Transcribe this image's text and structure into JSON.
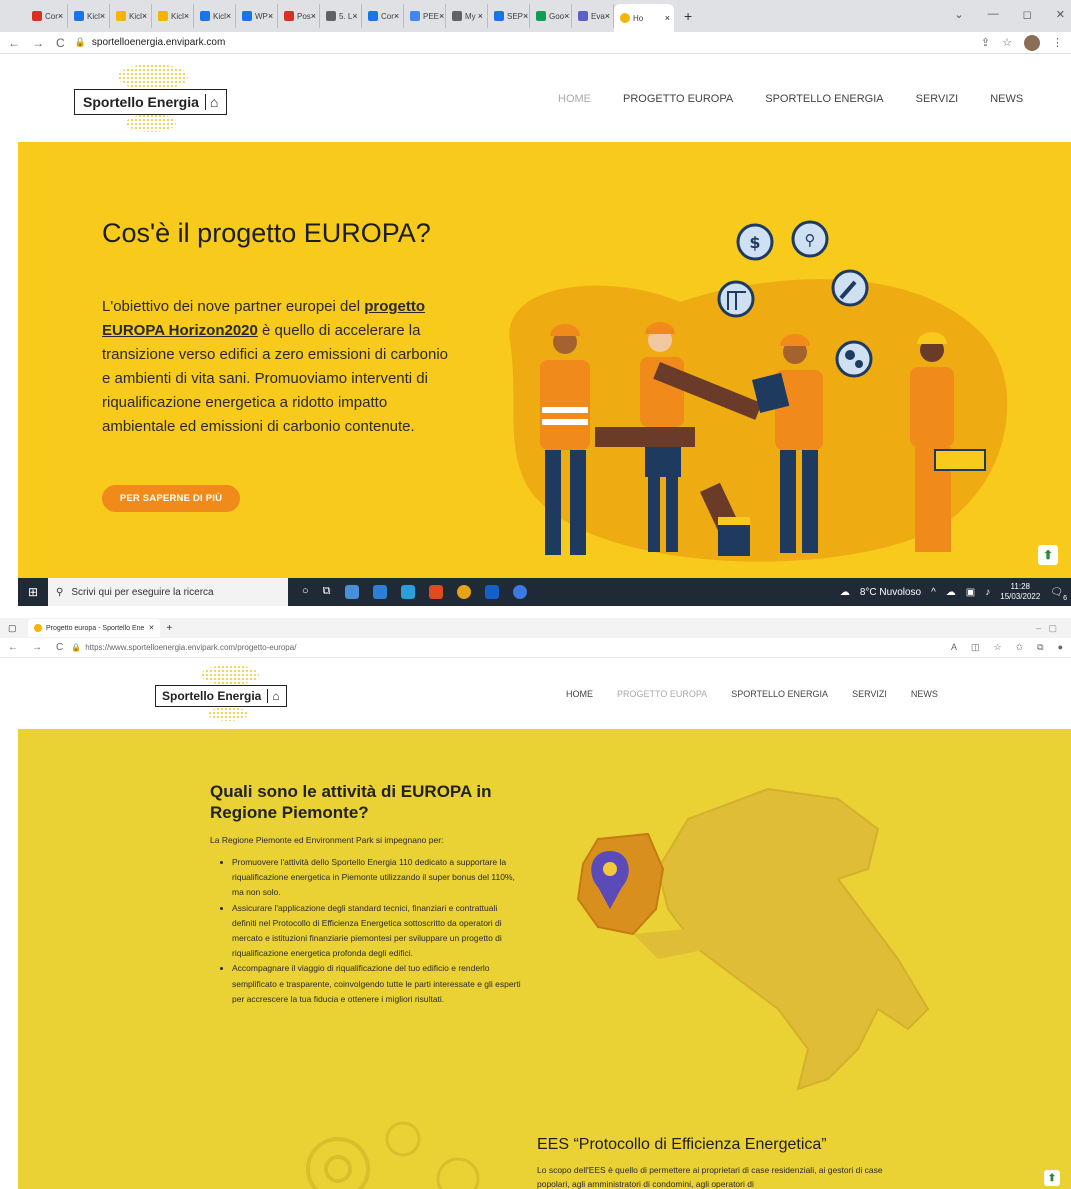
{
  "browser1": {
    "tabs": [
      {
        "label": "Cor",
        "color": "#d93025"
      },
      {
        "label": "Kicl",
        "color": "#1a73e8"
      },
      {
        "label": "Kicl",
        "color": "#f4b400"
      },
      {
        "label": "Kicl",
        "color": "#f4b400"
      },
      {
        "label": "Kicl",
        "color": "#1a73e8"
      },
      {
        "label": "WP",
        "color": "#1a73e8"
      },
      {
        "label": "Pos",
        "color": "#d93025"
      },
      {
        "label": "5. L",
        "color": "#5f6368"
      },
      {
        "label": "Cor",
        "color": "#1a73e8"
      },
      {
        "label": "PEE",
        "color": "#4285f4"
      },
      {
        "label": "My",
        "color": "#5f6368"
      },
      {
        "label": "SEP",
        "color": "#1a73e8"
      },
      {
        "label": "Goo",
        "color": "#0f9d58"
      },
      {
        "label": "Eva",
        "color": "#5b5fc7"
      }
    ],
    "active_tab": "Ho",
    "url": "sportelloenergia.envipark.com"
  },
  "site": {
    "logo_text": "Sportello Energia",
    "logo_symbol": "⌂",
    "menu": [
      "HOME",
      "PROGETTO EUROPA",
      "SPORTELLO ENERGIA",
      "SERVIZI",
      "NEWS"
    ]
  },
  "hero1": {
    "title": "Cos'è il progetto EUROPA?",
    "text_before": "L'obiettivo dei nove partner europei del ",
    "link_text": "progetto EUROPA Horizon2020",
    "text_after": " è quello di accelerare la transizione verso edifici a zero emissioni di carbonio e ambienti di vita sani. Promuoviamo interventi di riqualificazione energetica a ridotto impatto ambientale ed emissioni di carbonio contenute.",
    "cta": "PER SAPERNE DI PIÙ"
  },
  "taskbar": {
    "search_placeholder": "Scrivi qui per eseguire la ricerca",
    "weather": "8°C Nuvoloso",
    "time": "11:28",
    "date": "15/03/2022",
    "notification_count": "6"
  },
  "browser2": {
    "tab_title": "Progetto europa - Sportello Ene",
    "url": "https://www.sportelloenergia.envipark.com/progetto-europa/"
  },
  "section2": {
    "title": "Quali sono le attività di EUROPA in Regione Piemonte?",
    "intro": "La Regione Piemonte ed Environment Park si impegnano per:",
    "bullets": [
      "Promuovere l'attività dello Sportello Energia 110 dedicato a supportare la riqualificazione energetica in Piemonte utilizzando il super bonus del 110%, ma non solo.",
      "Assicurare l'applicazione degli standard tecnici, finanziari e contrattuali definiti nel Protocollo di Efficienza Energetica sottoscritto da operatori di mercato e istituzioni finanziarie piemontesi per sviluppare un progetto di riqualificazione energetica profonda degli edifici.",
      "Accompagnare il viaggio di riqualificazione del tuo edificio e renderlo semplificato e trasparente, coinvolgendo tutte le parti interessate e gli esperti per accrescere la tua fiducia e ottenere i migliori risultati."
    ],
    "ees_title": "EES “Protocollo di Efficienza Energetica”",
    "ees_text": "Lo scopo dell'EES è quello di permettere ai proprietari di case residenziali, ai gestori di case popolari, agli amministratori di condomini, agli operatori di"
  },
  "colors": {
    "hero1_bg": "#f7ca1c",
    "hero2_bg": "#ead234",
    "cta": "#f08a1b",
    "taskbar": "#1f2a36"
  }
}
